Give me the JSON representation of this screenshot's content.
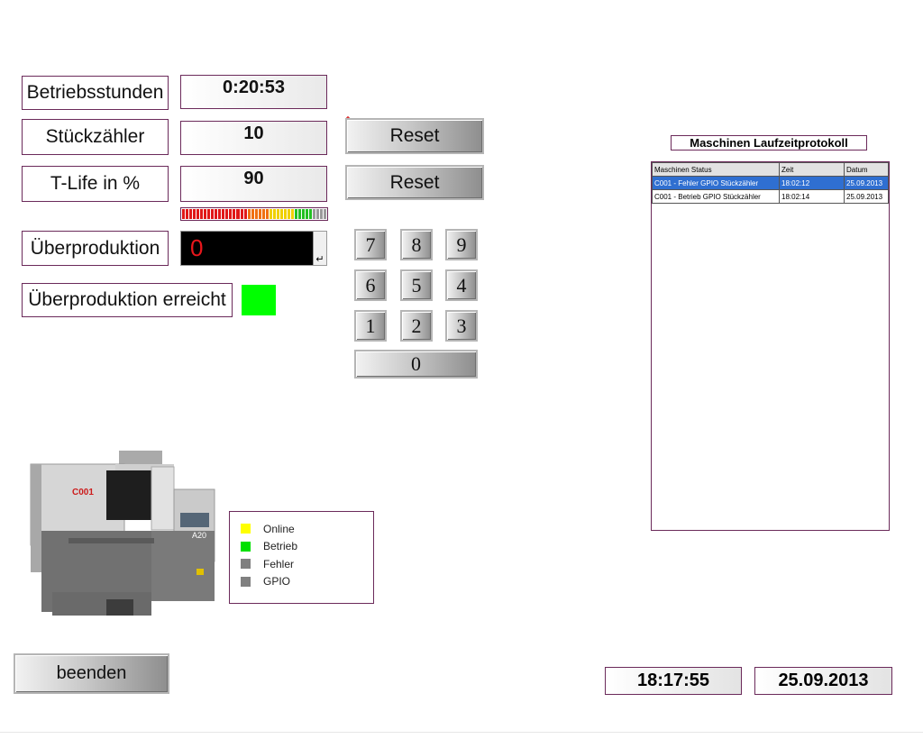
{
  "fields": {
    "betriebsstunden": {
      "label": "Betriebsstunden",
      "value": "0:20:53"
    },
    "stueckzaehler": {
      "label": "Stückzähler",
      "value": "10"
    },
    "tlife": {
      "label": "T-Life in %",
      "value": "90"
    },
    "ueberproduktion": {
      "label": "Überproduktion",
      "value": "0"
    },
    "ueberproduktion_erreicht": {
      "label": "Überproduktion erreicht",
      "status_color": "#00ff00"
    }
  },
  "buttons": {
    "reset1": "Reset",
    "reset2": "Reset",
    "beenden": "beenden"
  },
  "keypad": [
    "7",
    "8",
    "9",
    "6",
    "5",
    "4",
    "1",
    "2",
    "3",
    "0"
  ],
  "log": {
    "title": "Maschinen Laufzeitprotokoll",
    "columns": [
      "Maschinen Status",
      "Zeit",
      "Datum"
    ],
    "rows": [
      [
        "C001 - Fehler GPIO Stückzähler",
        "18:02:12",
        "25.09.2013"
      ],
      [
        "C001 -  Betrieb GPIO Stückzähler",
        "18:02:14",
        "25.09.2013"
      ]
    ]
  },
  "machine": {
    "id": "C001",
    "model": "A20"
  },
  "legend": [
    {
      "label": "Online",
      "color": "#ffff00"
    },
    {
      "label": "Betrieb",
      "color": "#00e000"
    },
    {
      "label": "Fehler",
      "color": "#808080"
    },
    {
      "label": "GPIO",
      "color": "#808080"
    }
  ],
  "time": "18:17:55",
  "date": "25.09.2013"
}
